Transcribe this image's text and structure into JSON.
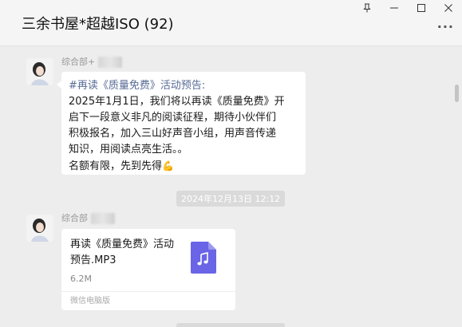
{
  "window": {
    "title": "三余书屋*超越ISO (92)",
    "controls": {
      "pin": "⊥",
      "minimize": "—",
      "maximize": "☐",
      "close": "✕"
    },
    "more": "···"
  },
  "messages": [
    {
      "sender": "综合部+",
      "lines": [
        {
          "text": "#再读《质量免费》活动预告:",
          "style": "highlight"
        },
        {
          "text": "2025年1月1日，我们将以再读《质量免费》开",
          "style": "normal"
        },
        {
          "text": "启下一段意义非凡的阅读征程，期待小伙伴们",
          "style": "normal"
        },
        {
          "text": "积极报名，加入三山好声音小组，用声音传递",
          "style": "normal"
        },
        {
          "text": "知识，用阅读点亮生活。。",
          "style": "normal"
        },
        {
          "text": "名额有限，先到先得",
          "style": "normal"
        }
      ],
      "emoji": "💪"
    }
  ],
  "timestamp": "2024年12月13日 12:12",
  "file_message": {
    "sender": "综合部",
    "file_name": "再读《质量免费》活动预告.MP3",
    "file_size": "6.2M",
    "footer": "微信电脑版"
  },
  "colors": {
    "background": "#ededed",
    "bubble": "#ffffff",
    "link": "#576b95",
    "file_icon": "#6a64e6"
  }
}
